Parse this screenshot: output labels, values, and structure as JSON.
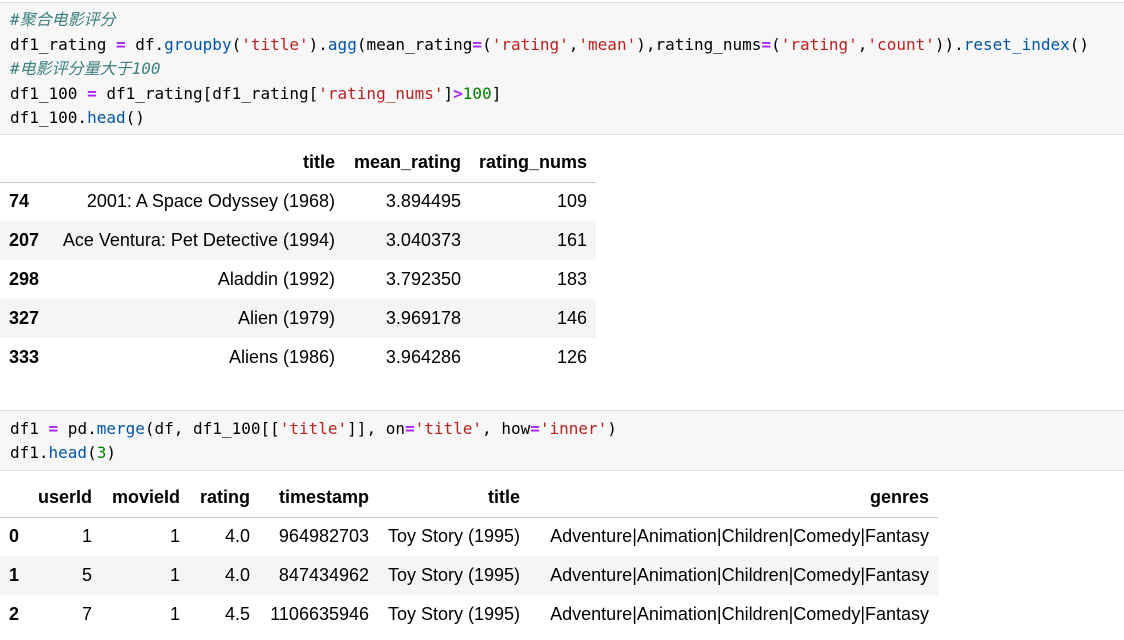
{
  "cell1": {
    "line1": "#聚合电影评分",
    "line2": {
      "a": "df1_rating ",
      "eq1": "=",
      "b": " df.",
      "groupby": "groupby",
      "c": "(",
      "s_title": "'title'",
      "d": ").",
      "agg": "agg",
      "e": "(mean_rating",
      "eq2": "=",
      "f": "(",
      "s_rating1": "'rating'",
      "g": ",",
      "s_mean": "'mean'",
      "h": "),rating_nums",
      "eq3": "=",
      "i": "(",
      "s_rating2": "'rating'",
      "j": ",",
      "s_count": "'count'",
      "k": ")).",
      "reset": "reset_index",
      "l": "()"
    },
    "line3": "#电影评分量大于100",
    "line4": {
      "a": "df1_100 ",
      "eq": "=",
      "b": " df1_rating[df1_rating[",
      "s_nums": "'rating_nums'",
      "c": "]",
      "gt": ">",
      "num": "100",
      "d": "]"
    },
    "line5": {
      "a": "df1_100.",
      "head": "head",
      "b": "()"
    }
  },
  "table1": {
    "columns": [
      "",
      "title",
      "mean_rating",
      "rating_nums"
    ],
    "rows": [
      {
        "index": "74",
        "title": "2001: A Space Odyssey (1968)",
        "mean_rating": "3.894495",
        "rating_nums": "109"
      },
      {
        "index": "207",
        "title": "Ace Ventura: Pet Detective (1994)",
        "mean_rating": "3.040373",
        "rating_nums": "161"
      },
      {
        "index": "298",
        "title": "Aladdin (1992)",
        "mean_rating": "3.792350",
        "rating_nums": "183"
      },
      {
        "index": "327",
        "title": "Alien (1979)",
        "mean_rating": "3.969178",
        "rating_nums": "146"
      },
      {
        "index": "333",
        "title": "Aliens (1986)",
        "mean_rating": "3.964286",
        "rating_nums": "126"
      }
    ]
  },
  "cell2": {
    "line1": {
      "a": "df1 ",
      "eq1": "=",
      "b": " pd.",
      "merge": "merge",
      "c": "(df, df1_100[[",
      "s_title1": "'title'",
      "d": "]], on",
      "eq2": "=",
      "s_title2": "'title'",
      "e": ", how",
      "eq3": "=",
      "s_inner": "'inner'",
      "f": ")"
    },
    "line2": {
      "a": "df1.",
      "head": "head",
      "b": "(",
      "num": "3",
      "c": ")"
    }
  },
  "table2": {
    "columns": [
      "",
      "userId",
      "movieId",
      "rating",
      "timestamp",
      "title",
      "genres"
    ],
    "rows": [
      {
        "index": "0",
        "userId": "1",
        "movieId": "1",
        "rating": "4.0",
        "timestamp": "964982703",
        "title": "Toy Story (1995)",
        "genres": "Adventure|Animation|Children|Comedy|Fantasy"
      },
      {
        "index": "1",
        "userId": "5",
        "movieId": "1",
        "rating": "4.0",
        "timestamp": "847434962",
        "title": "Toy Story (1995)",
        "genres": "Adventure|Animation|Children|Comedy|Fantasy"
      },
      {
        "index": "2",
        "userId": "7",
        "movieId": "1",
        "rating": "4.5",
        "timestamp": "1106635946",
        "title": "Toy Story (1995)",
        "genres": "Adventure|Animation|Children|Comedy|Fantasy"
      }
    ]
  }
}
